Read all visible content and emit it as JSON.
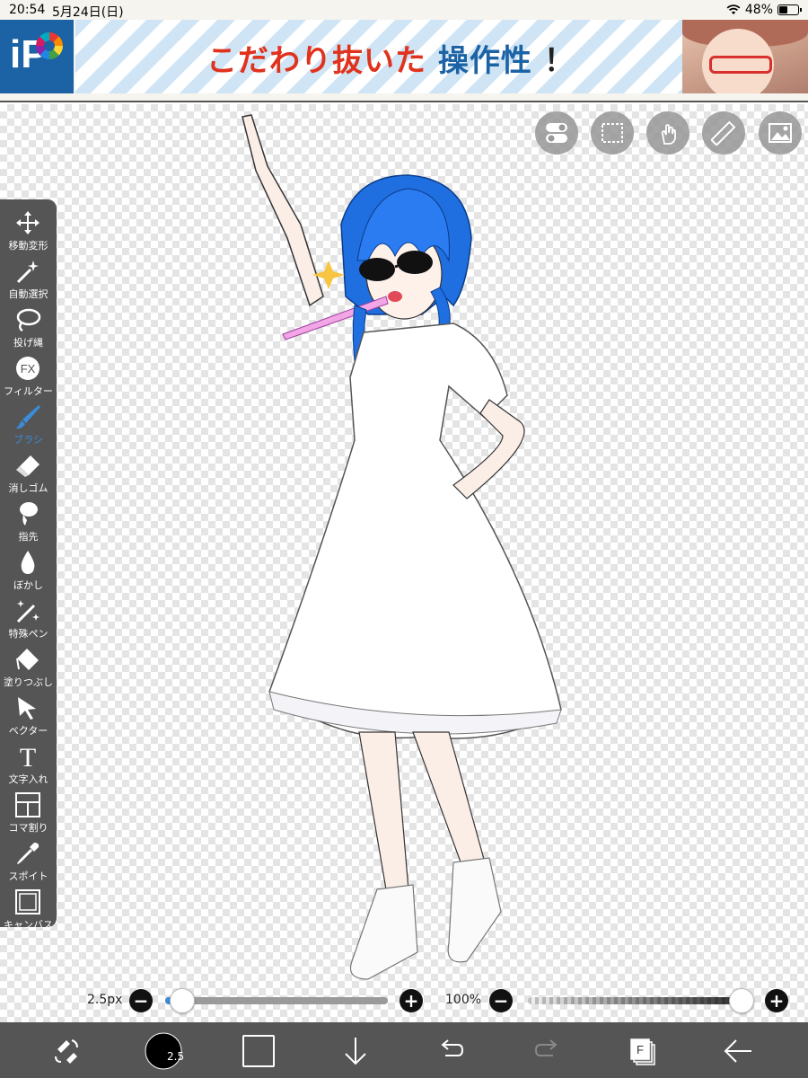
{
  "status_bar": {
    "time": "20:54",
    "date": "5月24日(日)",
    "battery_text": "48%",
    "battery_level": 0.48,
    "wifi_icon": "wifi-icon"
  },
  "ad_banner": {
    "logo_text": "iP",
    "headline_part1": "こだわり抜いた",
    "headline_part2": "操作性",
    "headline_part3": "！",
    "colors": {
      "red": "#e0321c",
      "blue": "#1c63a6"
    }
  },
  "top_buttons": [
    {
      "icon": "toggle-icon"
    },
    {
      "icon": "selection-icon"
    },
    {
      "icon": "hand-gesture-icon"
    },
    {
      "icon": "ruler-icon"
    },
    {
      "icon": "material-icon"
    }
  ],
  "tools": [
    {
      "label": "移動変形",
      "icon": "move-transform-icon"
    },
    {
      "label": "自動選択",
      "icon": "magic-wand-icon"
    },
    {
      "label": "投げ縄",
      "icon": "lasso-icon"
    },
    {
      "label": "フィルター",
      "icon": "fx-icon",
      "icon_text": "FX"
    },
    {
      "label": "ブラシ",
      "icon": "brush-icon",
      "active": true
    },
    {
      "label": "消しゴム",
      "icon": "eraser-icon"
    },
    {
      "label": "指先",
      "icon": "finger-smudge-icon"
    },
    {
      "label": "ぼかし",
      "icon": "blur-drop-icon"
    },
    {
      "label": "特殊ペン",
      "icon": "special-pen-icon"
    },
    {
      "label": "塗りつぶし",
      "icon": "fill-bucket-icon"
    },
    {
      "label": "ベクター",
      "icon": "vector-cursor-icon"
    },
    {
      "label": "文字入れ",
      "icon": "text-icon",
      "icon_text": "T"
    },
    {
      "label": "コマ割り",
      "icon": "frame-divider-icon"
    },
    {
      "label": "スポイト",
      "icon": "eyedropper-icon"
    },
    {
      "label": "キャンバス",
      "icon": "canvas-icon"
    }
  ],
  "brush_size_slider": {
    "value_text": "2.5px",
    "level": 0.03
  },
  "opacity_slider": {
    "value_text": "100%",
    "level": 1.0
  },
  "bottom_bar": {
    "brush_size_badge": "2.5",
    "active_color": "#000000",
    "secondary_color": "#555555",
    "layer_badge": "F",
    "items": [
      {
        "icon": "tool-swap-icon"
      },
      {
        "icon": "brush-size-icon"
      },
      {
        "icon": "color-swatch-icon"
      },
      {
        "icon": "download-arrow-icon"
      },
      {
        "icon": "undo-icon"
      },
      {
        "icon": "redo-icon"
      },
      {
        "icon": "layers-icon"
      },
      {
        "icon": "back-arrow-icon"
      }
    ]
  }
}
